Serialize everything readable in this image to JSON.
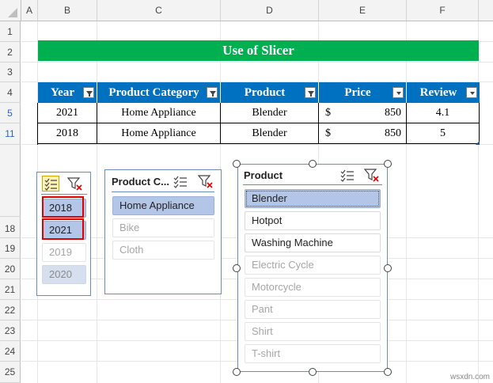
{
  "columns": [
    "A",
    "B",
    "C",
    "D",
    "E",
    "F"
  ],
  "rows": [
    "1",
    "2",
    "3",
    "4",
    "5",
    "11",
    "",
    "18",
    "19",
    "20",
    "21",
    "22",
    "23",
    "24",
    "25"
  ],
  "title": "Use of Slicer",
  "table": {
    "headers": [
      "Year",
      "Product Category",
      "Product",
      "Price",
      "Review"
    ],
    "rows": [
      {
        "year": "2021",
        "category": "Home Appliance",
        "product": "Blender",
        "currency": "$",
        "price": "850",
        "review": "4.1"
      },
      {
        "year": "2018",
        "category": "Home Appliance",
        "product": "Blender",
        "currency": "$",
        "price": "850",
        "review": "5"
      }
    ]
  },
  "year_slicer": {
    "items": [
      "2018",
      "2021",
      "2019",
      "2020"
    ]
  },
  "category_slicer": {
    "title": "Product C...",
    "items": [
      "Home Appliance",
      "Bike",
      "Cloth"
    ]
  },
  "product_slicer": {
    "title": "Product",
    "items": [
      "Blender",
      "Hotpot",
      "Washing Machine",
      "Electric Cycle",
      "Motorcycle",
      "Pant",
      "Shirt",
      "T-shirt"
    ]
  },
  "watermark": "wsxdn.com",
  "colors": {
    "title_bg": "#00b050",
    "header_bg": "#0070c0",
    "selected_item": "#b4c6e7",
    "highlight": "#e00000"
  }
}
